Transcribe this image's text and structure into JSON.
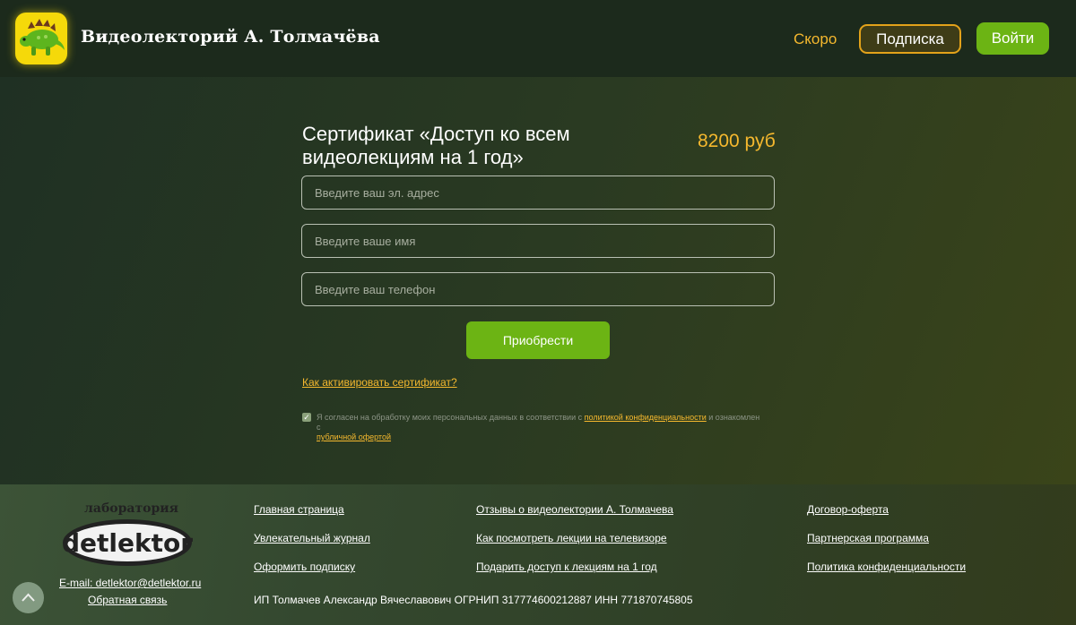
{
  "header": {
    "brand": "Видеолекторий А. Толмачёва",
    "nav_soon": "Скоро",
    "subscribe_label": "Подписка",
    "login_label": "Войти"
  },
  "main": {
    "title": "Сертификат «Доступ ко всем видеолекциям на 1 год»",
    "price": "8200 руб",
    "email_placeholder": "Введите ваш эл. адрес",
    "name_placeholder": "Введите ваше имя",
    "phone_placeholder": "Введите ваш телефон",
    "buy_label": "Приобрести",
    "activate_link": "Как активировать сертификат?",
    "consent": {
      "checked": true,
      "text_before": "Я согласен на обработку моих персональных данных в соответствии с",
      "privacy_link": "политикой конфиденциальности",
      "text_middle": "и ознакомлен с",
      "offer_link": "публичной офертой"
    }
  },
  "footer": {
    "lab_text": "лаборатория",
    "logo_text": "detlektor",
    "email": "E-mail: detlektor@detlektor.ru",
    "feedback": "Обратная связь",
    "links_col1": [
      "Главная страница",
      "Увлекательный журнал",
      "Оформить подписку"
    ],
    "links_col2": [
      "Отзывы о видеолектории А. Толмачева",
      "Как посмотреть лекции на телевизоре",
      "Подарить доступ к лекциям на 1 год"
    ],
    "links_col3": [
      "Договор-оферта",
      "Партнерская программа",
      "Политика конфиденциальности"
    ],
    "legal": "ИП Толмачев Александр Вячеславович ОГРНИП 317774600212887 ИНН 771870745805"
  },
  "colors": {
    "accent_green": "#6cb414",
    "accent_orange": "#f5b82e",
    "logo_yellow": "#f5d90a"
  }
}
